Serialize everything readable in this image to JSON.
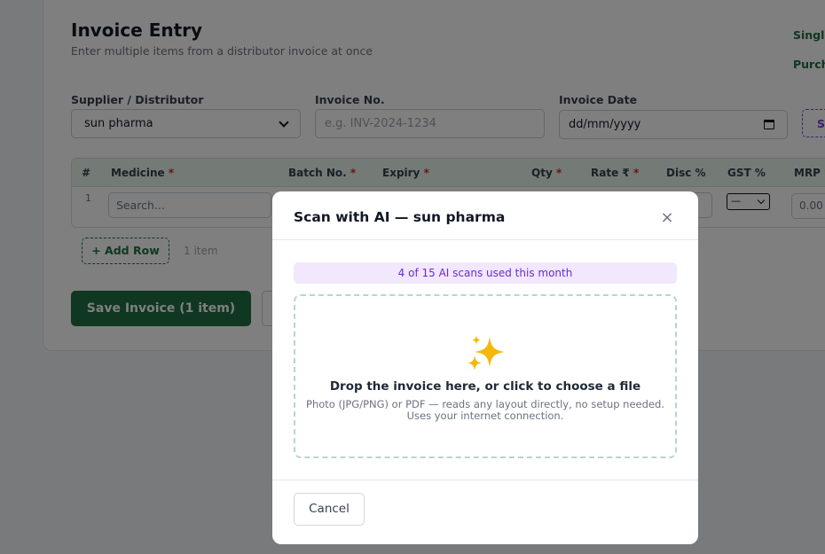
{
  "page": {
    "title": "Invoice Entry",
    "subtitle": "Enter multiple items from a distributor invoice at once",
    "right_links": [
      "Single",
      "Purch"
    ]
  },
  "form": {
    "supplier_label": "Supplier / Distributor",
    "supplier_value": "sun pharma",
    "invoice_no_label": "Invoice No.",
    "invoice_no_placeholder": "e.g. INV-2024-1234",
    "invoice_date_label": "Invoice Date",
    "invoice_date_placeholder": "dd/mm/yyyy",
    "scan_button_label": "Sc"
  },
  "table": {
    "columns": [
      {
        "label": "#",
        "required": false
      },
      {
        "label": "Medicine",
        "required": true
      },
      {
        "label": "Batch No.",
        "required": true
      },
      {
        "label": "Expiry",
        "required": true
      },
      {
        "label": "Qty",
        "required": true
      },
      {
        "label": "Rate ₹",
        "required": true
      },
      {
        "label": "Disc %",
        "required": false
      },
      {
        "label": "GST %",
        "required": false
      },
      {
        "label": "MRP ₹",
        "required": false
      }
    ],
    "row": {
      "number": "1",
      "medicine_placeholder": "Search...",
      "gst_value": "—",
      "mrp_placeholder": "0.00"
    }
  },
  "actions": {
    "add_row_label": "+ Add Row",
    "item_count": "1 item",
    "save_label": "Save Invoice (1 item)"
  },
  "modal": {
    "title": "Scan with AI — sun pharma",
    "close_symbol": "×",
    "usage_text": "4 of 15 AI scans used this month",
    "drop_title": "Drop the invoice here, or click to choose a file",
    "drop_sub_line1": "Photo (JPG/PNG) or PDF — reads any layout directly, no setup needed.",
    "drop_sub_line2": "Uses your internet connection.",
    "cancel_label": "Cancel",
    "icon": "sparkles-icon"
  },
  "colors": {
    "primary": "#1f6f43",
    "accent": "#7c3aed",
    "required": "#dc2626",
    "usage_bg": "#f1e8fd",
    "sparkle": "#f5b70a"
  }
}
